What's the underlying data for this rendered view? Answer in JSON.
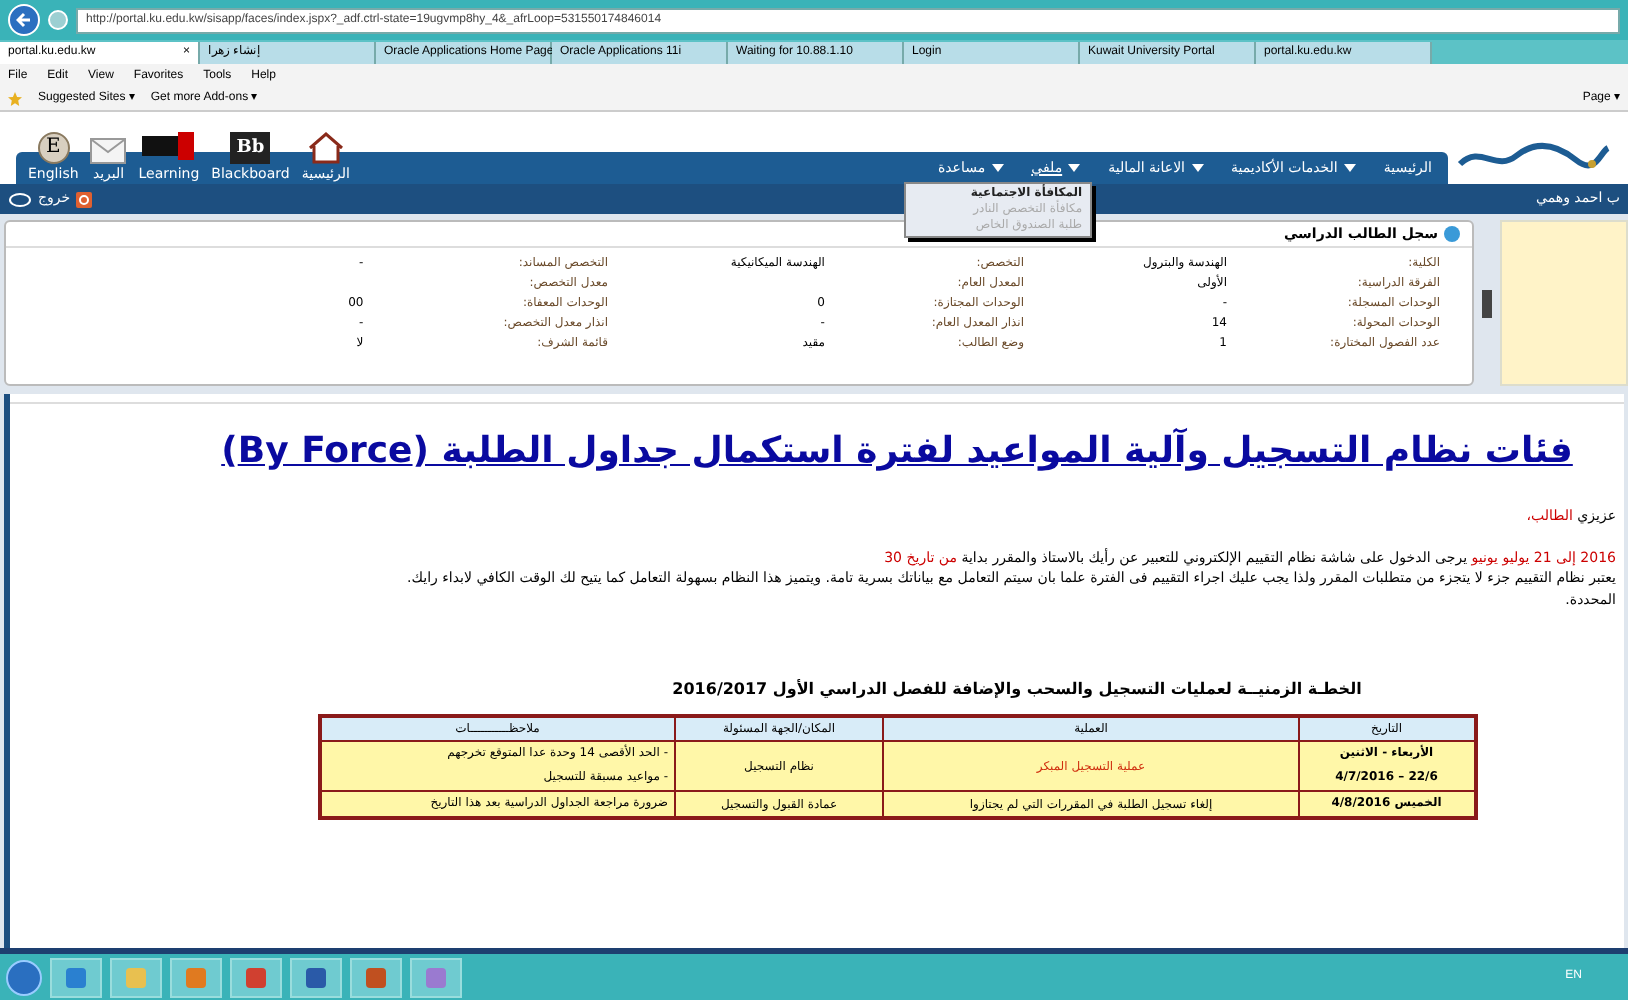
{
  "browser": {
    "url": "http://portal.ku.edu.kw/sisapp/faces/index.jspx?_adf.ctrl-state=19ugvmp8hy_4&_afrLoop=531550174846014",
    "tabs": [
      {
        "label": "portal.ku.edu.kw",
        "selected": false
      },
      {
        "label": "Kuwait University Portal",
        "selected": false
      },
      {
        "label": "Login",
        "selected": false
      },
      {
        "label": "Waiting for 10.88.1.10",
        "selected": false
      },
      {
        "label": "Oracle Applications 11i",
        "selected": false
      },
      {
        "label": "Oracle Applications Home Page",
        "selected": false
      },
      {
        "label": "إنشاء زهرا",
        "selected": false
      },
      {
        "label": "portal.ku.edu.kw",
        "selected": true,
        "close": "×"
      }
    ],
    "menu": [
      "Help",
      "Tools",
      "Favorites",
      "View",
      "Edit",
      "File"
    ],
    "favorites": [
      "Get more Add-ons ▾",
      "Suggested Sites ▾"
    ],
    "page_menu": "Page ▾"
  },
  "portal": {
    "shortcuts": [
      {
        "kind": "home",
        "label": "الرئيسية"
      },
      {
        "kind": "bb",
        "glyph": "Bb",
        "label": "Blackboard"
      },
      {
        "kind": "track",
        "label": "Learning"
      },
      {
        "kind": "mail",
        "label": "البريد"
      },
      {
        "kind": "letter",
        "glyph": "E",
        "label": "English"
      }
    ],
    "nav": [
      {
        "label": "الرئيسية",
        "dropdown": false,
        "expanded": false
      },
      {
        "label": "الخدمات الأكاديمية",
        "dropdown": true,
        "expanded": false
      },
      {
        "label": "الاعانة المالية",
        "dropdown": true,
        "expanded": false
      },
      {
        "label": "ملفي",
        "dropdown": true,
        "expanded": true,
        "items": [
          {
            "label": "المكافأة الاجتماعية",
            "disabled": false
          },
          {
            "label": "مكافأة التخصص النادر",
            "disabled": true
          },
          {
            "label": "طلبة الصندوق الخاص",
            "disabled": true
          }
        ]
      },
      {
        "label": "مساعدة",
        "dropdown": true,
        "expanded": false
      }
    ],
    "logout": "خروج",
    "user": "ب احمد وهمي"
  },
  "record": {
    "title": "سجل الطالب الدراسي",
    "columns": [
      [
        {
          "label": "الكلية:",
          "value": "الهندسة والبترول"
        },
        {
          "label": "الفرقة الدراسية:",
          "value": "الأولى"
        },
        {
          "label": "الوحدات المسجلة:",
          "value": "-"
        },
        {
          "label": "الوحدات المحولة:",
          "value": "14"
        },
        {
          "label": "عدد الفصول المختارة:",
          "value": "1"
        }
      ],
      [
        {
          "label": "التخصص:",
          "value": "الهندسة الميكانيكية"
        },
        {
          "label": "المعدل العام:"
        },
        {
          "label": "الوحدات المجتازة:",
          "value": "0"
        },
        {
          "label": "انذار المعدل العام:",
          "value": "-"
        },
        {
          "label": "وضع الطالب:",
          "value": "مقيد"
        }
      ],
      [
        {
          "label": "التخصص المساند:",
          "value": "-"
        },
        {
          "label": "معدل التخصص:"
        },
        {
          "label": "الوحدات المعفاة:",
          "value": "00"
        },
        {
          "label": "انذار معدل التخصص:",
          "value": "-"
        },
        {
          "label": "قائمة الشرف:",
          "value": "لا"
        }
      ]
    ]
  },
  "article": {
    "heading": "فئات نظام التسجيل وآلية المواعيد لفترة استكمال جداول الطلبة (By Force)",
    "greeting": [
      {
        "text": "عزيزي ",
        "highlight": false
      },
      {
        "text": "الطالب،",
        "highlight": true
      }
    ],
    "paragraph": [
      {
        "text": "2016 إلى 21 يوليو يونيو",
        "highlight": true
      },
      {
        "text": " يرجى الدخول على شاشة نظام التقييم الإلكتروني للتعبير عن رأيك بالاستاذ والمقرر بداية ",
        "highlight": false
      },
      {
        "text": "من تاريخ 30",
        "highlight": true
      }
    ],
    "paragraph_2": "يعتبر نظام التقييم جزء لا يتجزء من متطلبات المقرر ولذا يجب عليك اجراء التقييم فى الفترة  علما بان سيتم التعامل مع بياناتك بسرية تامة. ويتميز هذا النظام بسهولة التعامل كما يتيح لك الوقت الكافي لابداء رايك.",
    "paragraph_3": "المحددة.",
    "table_title": "الخطـة الزمنيــة لعمليات التسجيل والسحب والإضافة للفصل الدراسي الأول **2016/2017**",
    "table": {
      "columns": [
        "التاريخ",
        "العملية",
        "المكان/الجهة المسئولة",
        "ملاحظـــــــــــات"
      ],
      "rows": [
        {
          "date": [
            "الأربعاء - الاثنين",
            "22/6 – 4/7/2016"
          ],
          "process": "عملية التسجيل المبكر",
          "process_highlight": true,
          "place": "نظام التسجيل",
          "notes": [
            "- الحد الأقصى 14 وحدة عدا المتوقع تخرجهم",
            "- مواعيد مسبقة للتسجيل"
          ]
        },
        {
          "date": [
            "الخميس 4/8/2016"
          ],
          "process": "إلغاء تسجيل الطلبة في المقررات التي لم يجتازوا",
          "process_highlight": false,
          "place": "عمادة القبول والتسجيل",
          "notes": [
            "ضرورة مراجعة الجداول الدراسية بعد هذا التاريخ"
          ]
        }
      ]
    }
  },
  "taskbar": {
    "apps": [
      {
        "kind": "explorer"
      },
      {
        "kind": "folder"
      },
      {
        "kind": "media"
      },
      {
        "kind": "chrome"
      },
      {
        "kind": "word"
      },
      {
        "kind": "java"
      },
      {
        "kind": "paint"
      }
    ],
    "language": "EN"
  }
}
